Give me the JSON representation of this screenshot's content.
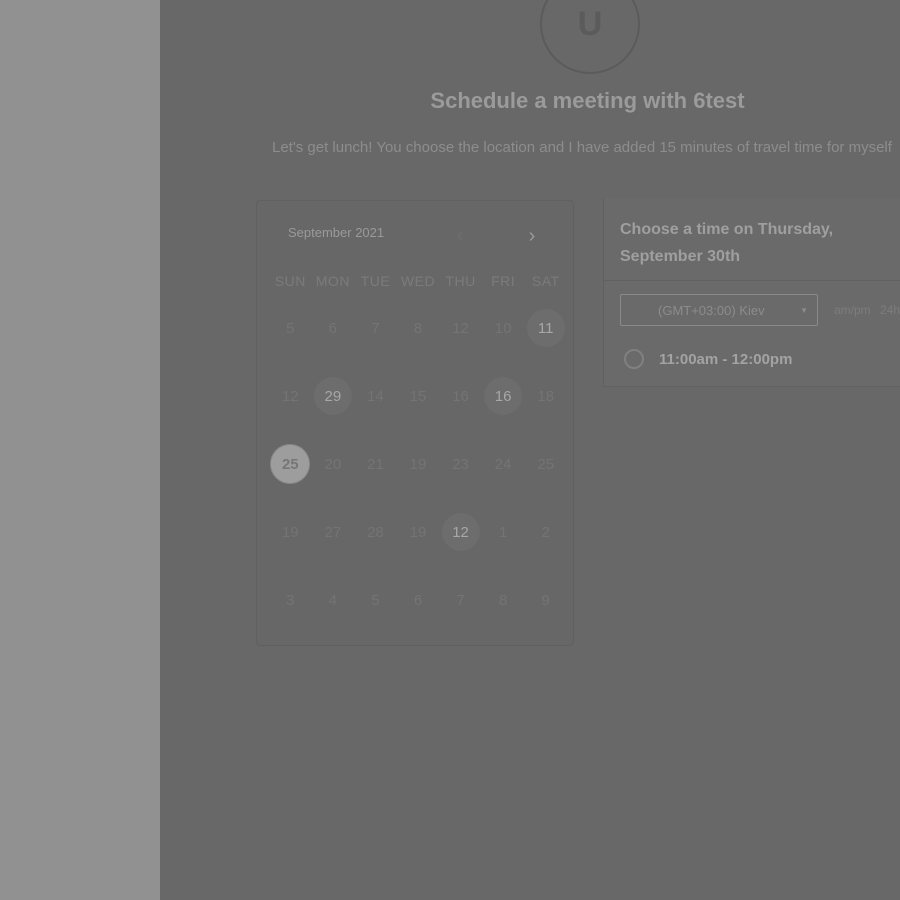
{
  "avatar": {
    "initial": "U"
  },
  "header": {
    "title": "Schedule a meeting with 6test",
    "description": "Let's get lunch! You choose the location and I have added 15 minutes of travel time for myself"
  },
  "calendar": {
    "month_label": "September 2021",
    "prev_icon": "chevron-left-icon",
    "next_icon": "chevron-right-icon",
    "weekdays": [
      "SUN",
      "MON",
      "TUE",
      "WED",
      "THU",
      "FRI",
      "SAT"
    ],
    "weeks": [
      [
        {
          "day": "5",
          "state": "disabled"
        },
        {
          "day": "6",
          "state": "disabled"
        },
        {
          "day": "7",
          "state": "disabled"
        },
        {
          "day": "8",
          "state": "disabled"
        },
        {
          "day": "12",
          "state": "disabled"
        },
        {
          "day": "10",
          "state": "disabled"
        },
        {
          "day": "11",
          "state": "available"
        }
      ],
      [
        {
          "day": "12",
          "state": "disabled"
        },
        {
          "day": "29",
          "state": "available"
        },
        {
          "day": "14",
          "state": "disabled"
        },
        {
          "day": "15",
          "state": "disabled"
        },
        {
          "day": "16",
          "state": "disabled"
        },
        {
          "day": "16",
          "state": "available"
        },
        {
          "day": "18",
          "state": "disabled"
        }
      ],
      [
        {
          "day": "25",
          "state": "selected"
        },
        {
          "day": "20",
          "state": "disabled"
        },
        {
          "day": "21",
          "state": "disabled"
        },
        {
          "day": "19",
          "state": "disabled"
        },
        {
          "day": "23",
          "state": "disabled"
        },
        {
          "day": "24",
          "state": "disabled"
        },
        {
          "day": "25",
          "state": "disabled"
        }
      ],
      [
        {
          "day": "19",
          "state": "disabled"
        },
        {
          "day": "27",
          "state": "disabled"
        },
        {
          "day": "28",
          "state": "disabled"
        },
        {
          "day": "19",
          "state": "disabled"
        },
        {
          "day": "12",
          "state": "available"
        },
        {
          "day": "1",
          "state": "disabled"
        },
        {
          "day": "2",
          "state": "disabled"
        }
      ],
      [
        {
          "day": "3",
          "state": "disabled"
        },
        {
          "day": "4",
          "state": "disabled"
        },
        {
          "day": "5",
          "state": "disabled"
        },
        {
          "day": "6",
          "state": "disabled"
        },
        {
          "day": "7",
          "state": "disabled"
        },
        {
          "day": "8",
          "state": "disabled"
        },
        {
          "day": "9",
          "state": "disabled"
        }
      ]
    ]
  },
  "times": {
    "heading": "Choose a time on Thursday, September 30th",
    "timezone": "(GMT+03:00) Kiev",
    "dropdown_icon": "caret-down-icon",
    "format_options": [
      "am/pm",
      "24h"
    ],
    "slots": [
      "11:00am - 12:00pm"
    ]
  },
  "colors": {
    "overlay": "#686868",
    "left_strip": "#919191",
    "selected_day": "#9d9d9d"
  }
}
